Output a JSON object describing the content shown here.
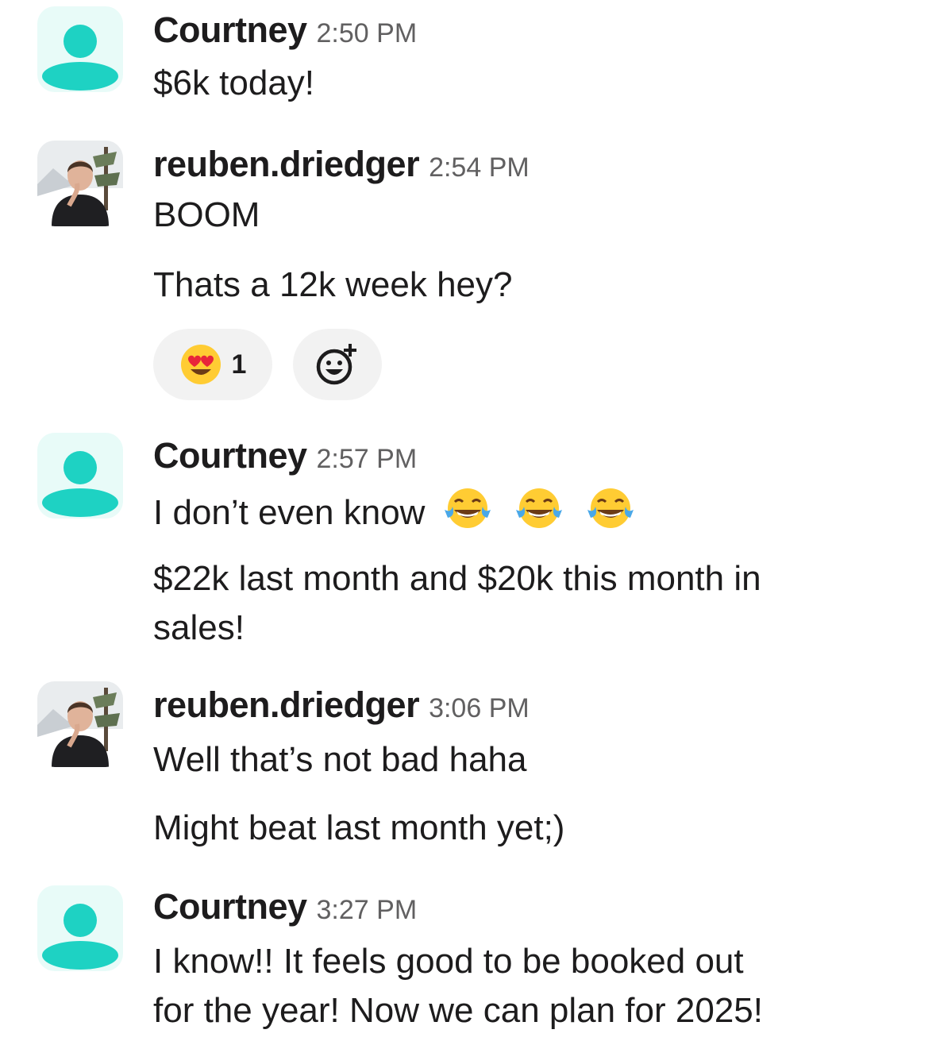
{
  "messages": [
    {
      "author": "Courtney",
      "time": "2:50 PM",
      "lines": [
        "$6k today!"
      ]
    },
    {
      "author": "reuben.driedger",
      "time": "2:54 PM",
      "lines": [
        "BOOM",
        "Thats a 12k week hey?"
      ],
      "reactions": [
        {
          "emoji": "heart-eyes-emoji",
          "count": "1"
        }
      ],
      "add_reaction_icon": "add-reaction-icon"
    },
    {
      "author": "Courtney",
      "time": "2:57 PM",
      "lines": [
        "I don’t even know",
        "$22k last month and $20k this month in",
        "sales!"
      ],
      "inline_emojis": [
        "tears-of-joy-emoji",
        "tears-of-joy-emoji",
        "tears-of-joy-emoji"
      ]
    },
    {
      "author": "reuben.driedger",
      "time": "3:06 PM",
      "lines": [
        "Well that’s not bad haha",
        "Might beat last month yet;)"
      ]
    },
    {
      "author": "Courtney",
      "time": "3:27 PM",
      "lines": [
        "I know!! It feels good to be booked out",
        "for the year! Now we can plan for 2025!"
      ]
    }
  ],
  "colors": {
    "avatar_accent": "#1ed2c3",
    "avatar_bg": "#e8fbf8",
    "timestamp": "#616061",
    "reaction_bg": "#f2f2f2"
  }
}
